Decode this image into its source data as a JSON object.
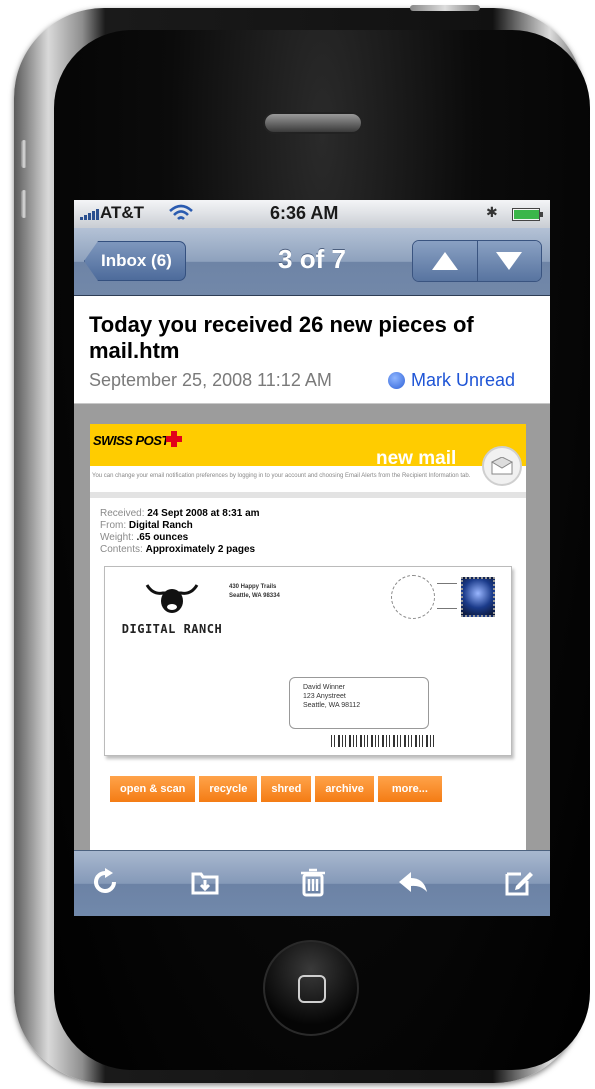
{
  "status_bar": {
    "carrier": "AT&T",
    "time": "6:36 AM",
    "battery_level": 0.95
  },
  "nav": {
    "back_label": "Inbox (6)",
    "title": "3 of 7",
    "prev_icon": "triangle-up-icon",
    "next_icon": "triangle-down-icon"
  },
  "message": {
    "subject": "Today you received 26 new pieces of mail.htm",
    "date": "September 25, 2008 11:12 AM",
    "mark_unread_label": "Mark Unread"
  },
  "mail_content": {
    "brand": "SWISS POST",
    "banner_text": "new mail",
    "preference_note": "You can change your email notification preferences by logging in to your account and choosing Email Alerts from the Recipient Information tab.",
    "details": [
      {
        "label": "Received:",
        "value": "24 Sept 2008 at 8:31 am"
      },
      {
        "label": "From:",
        "value": "Digital Ranch"
      },
      {
        "label": "Weight:",
        "value": ".65 ounces"
      },
      {
        "label": "Contents:",
        "value": "Approximately 2 pages"
      }
    ],
    "envelope": {
      "sender_logo_text": "DIGITAL RANCH",
      "return_address": [
        "430 Happy Trails",
        "Seattle, WA 98334"
      ],
      "recipient": [
        "David Winner",
        "123 Anystreet",
        "Seattle, WA 98112"
      ]
    },
    "actions": [
      "open & scan",
      "recycle",
      "shred",
      "archive",
      "more..."
    ]
  },
  "toolbar": {
    "icons": [
      "refresh-icon",
      "move-to-folder-icon",
      "trash-icon",
      "reply-icon",
      "compose-icon"
    ]
  }
}
